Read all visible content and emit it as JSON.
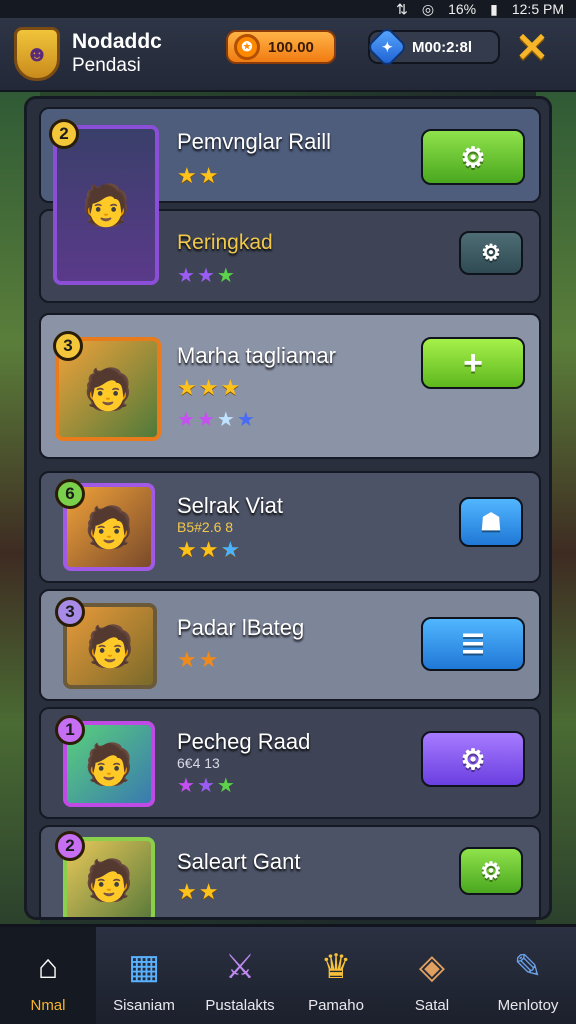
{
  "status_bar": {
    "time": "12:5 PM",
    "battery": "16%"
  },
  "header": {
    "player_name_line1": "Nodaddc",
    "player_name_line2": "Pendasi",
    "coins": "100.00",
    "gems": "M00:2:8l"
  },
  "heroes": [
    {
      "name": "Pemvnglar Raill",
      "level": "2",
      "stars": "★★",
      "button_icon": "gear-icon"
    },
    {
      "name": "Reringkad",
      "level": "",
      "stars": "★★★",
      "button_icon": "gear-icon"
    },
    {
      "name": "Marha tagliamar",
      "level": "3",
      "stars": "★★★",
      "button_icon": "plus-icon"
    },
    {
      "name": "Selrak Viat",
      "subtitle": "B5#2.6 8",
      "level": "6",
      "stars": "★★★",
      "button_icon": "robot-icon"
    },
    {
      "name": "Padar lBateg",
      "level": "3",
      "stars": "★★",
      "button_icon": "list-icon"
    },
    {
      "name": "Pecheg Raad",
      "subtitle": "6€4 13",
      "level": "1",
      "stars": "★★★",
      "button_icon": "gear-icon"
    },
    {
      "name": "Saleart Gant",
      "level": "2",
      "stars": "★★",
      "button_icon": "gear-icon"
    }
  ],
  "nav": [
    {
      "label": "Nmal",
      "icon": "home-icon",
      "active": true
    },
    {
      "label": "Sisaniam",
      "icon": "squad-icon",
      "active": false
    },
    {
      "label": "Pustalakts",
      "icon": "sword-icon",
      "active": false
    },
    {
      "label": "Pamaho",
      "icon": "trophy-icon",
      "active": false
    },
    {
      "label": "Satal",
      "icon": "map-icon",
      "active": false
    },
    {
      "label": "Menlotoy",
      "icon": "pencil-icon",
      "active": false
    }
  ]
}
